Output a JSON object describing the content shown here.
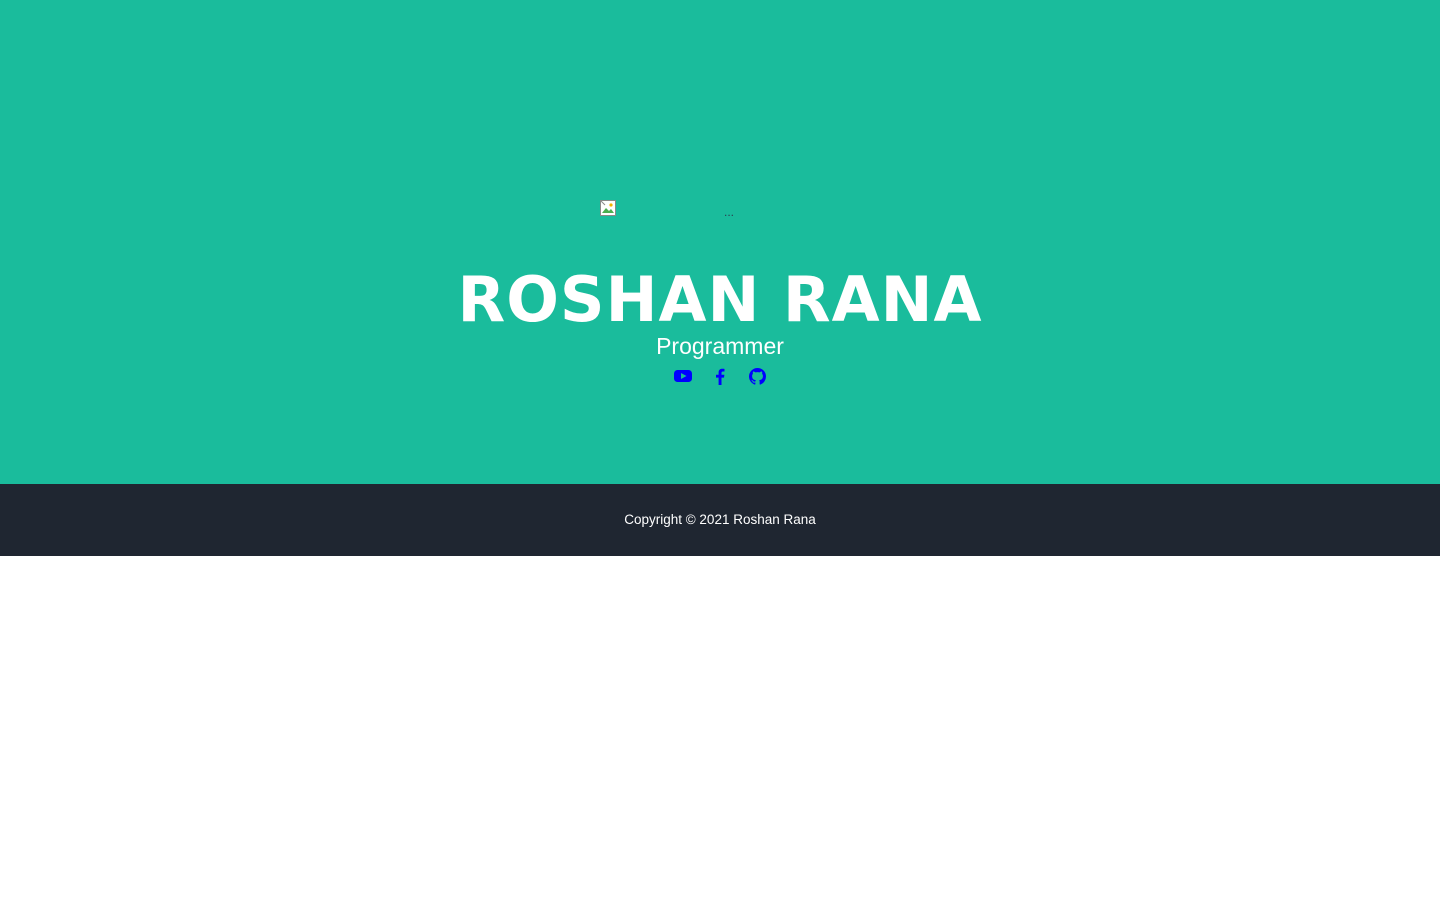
{
  "hero": {
    "avatar_alt": "...",
    "name": "ROSHAN RANA",
    "role": "Programmer",
    "social": [
      {
        "icon": "youtube-icon",
        "color": "#0000ff"
      },
      {
        "icon": "facebook-icon",
        "color": "#0000ff"
      },
      {
        "icon": "github-icon",
        "color": "#0000ff"
      }
    ]
  },
  "footer": {
    "copyright": "Copyright © 2021 Roshan Rana"
  },
  "colors": {
    "masthead_bg": "#1abc9c",
    "footer_bg": "#1f2631",
    "link": "#0000ff"
  }
}
